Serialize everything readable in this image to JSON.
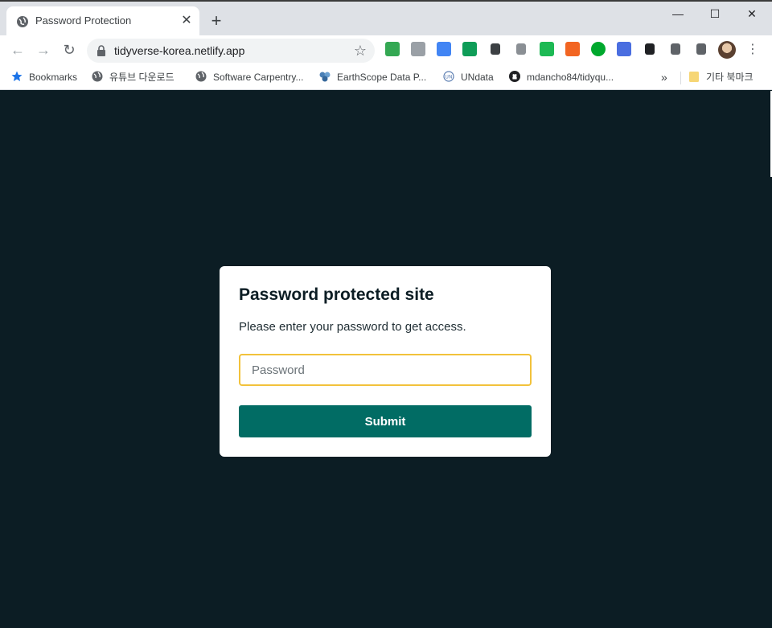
{
  "browser": {
    "tab": {
      "title": "Password Protection",
      "close_glyph": "✕"
    },
    "new_tab_glyph": "+",
    "window_controls": {
      "minimize": "—",
      "maximize": "☐",
      "close": "✕"
    },
    "nav": {
      "back": "←",
      "forward": "→",
      "reload": "↻"
    },
    "url": "tidyverse-korea.netlify.app",
    "star_glyph": "☆",
    "menu_glyph": "⋮",
    "extensions": [
      {
        "name": "google-drive-icon",
        "color": "#34a853"
      },
      {
        "name": "drive-grey-icon",
        "color": "#9aa0a6"
      },
      {
        "name": "google-translate-icon",
        "color": "#4285f4"
      },
      {
        "name": "green-extension-icon",
        "color": "#0f9d58"
      },
      {
        "name": "eyedropper-icon",
        "color": "#3c4043"
      },
      {
        "name": "brush-icon",
        "color": "#8a8f94"
      },
      {
        "name": "green-square-icon",
        "color": "#1db954"
      },
      {
        "name": "ex-icon",
        "color": "#f26522"
      },
      {
        "name": "evernote-icon",
        "color": "#00a82d"
      },
      {
        "name": "blue-gem-icon",
        "color": "#4a6ee0"
      },
      {
        "name": "cursor-icon",
        "color": "#202124"
      },
      {
        "name": "puzzle-icon",
        "color": "#5f6368"
      },
      {
        "name": "playlist-icon",
        "color": "#5f6368"
      }
    ]
  },
  "bookmarks": {
    "items": [
      {
        "label": "Bookmarks",
        "icon": "star-icon"
      },
      {
        "label": "유튜브 다운로드",
        "icon": "globe-icon"
      },
      {
        "label": "Software Carpentry...",
        "icon": "globe-icon"
      },
      {
        "label": "EarthScope Data P...",
        "icon": "earthscope-icon"
      },
      {
        "label": "UNdata",
        "icon": "un-icon"
      },
      {
        "label": "mdancho84/tidyqu...",
        "icon": "github-icon"
      }
    ],
    "more_glyph": "»",
    "other": {
      "label": "기타 북마크",
      "icon": "folder-icon"
    }
  },
  "card": {
    "title": "Password protected site",
    "subtitle": "Please enter your password to get access.",
    "input_placeholder": "Password",
    "input_value": "",
    "submit_label": "Submit"
  },
  "colors": {
    "page_bg": "#0c1d24",
    "submit_bg": "#016c64",
    "input_focus_border": "#f2c23b"
  }
}
